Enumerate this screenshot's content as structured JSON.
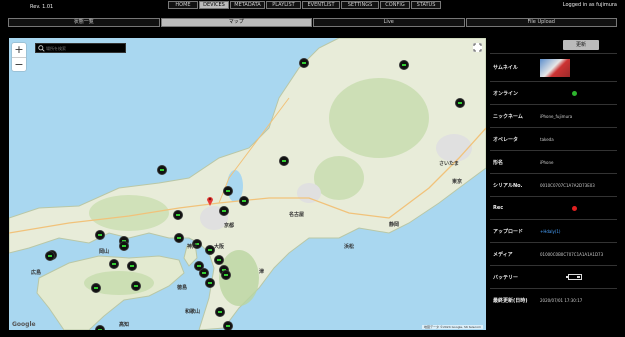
{
  "header": {
    "version": "Rev. 1.01",
    "login": "Logged in as fujimura"
  },
  "nav": [
    "HOME",
    "DEVICES",
    "METADATA",
    "PLAYLIST",
    "EVENTLIST",
    "SETTINGS",
    "CONFIG",
    "STATUS"
  ],
  "nav_active": "DEVICES",
  "subtabs": [
    "状態一覧",
    "マップ",
    "Live",
    "File Upload"
  ],
  "subtab_active": "マップ",
  "map": {
    "search_placeholder": "場所を検索",
    "zoom_in": "+",
    "zoom_out": "−",
    "google": "Google",
    "attribution": "地図データ ©2024 Google, SK telecom",
    "labels": [
      "さいたま",
      "東京",
      "名古屋",
      "静岡",
      "浜松",
      "京都",
      "大阪",
      "神戸",
      "岡山",
      "広島",
      "徳島",
      "高知",
      "和歌山",
      "津"
    ]
  },
  "panel": {
    "update_label": "更新",
    "rows": [
      {
        "label": "サムネイル",
        "type": "thumb"
      },
      {
        "label": "オンライン",
        "type": "dot",
        "color": "#2db52d"
      },
      {
        "label": "ニックネーム",
        "value": "iPhone_fujimura"
      },
      {
        "label": "オペレータ",
        "value": "takeda"
      },
      {
        "label": "形名",
        "value": "iPhone"
      },
      {
        "label": "シリアルNo.",
        "value": "0010C0707C1A7A2D73E03"
      },
      {
        "label": "Rec",
        "type": "dot",
        "color": "#e02020"
      },
      {
        "label": "アップロード",
        "value": "+Hdaly(1)",
        "link": true
      },
      {
        "label": "メディア",
        "value": "01000C0B0C707C1A1A1A1D73"
      },
      {
        "label": "バッテリー",
        "type": "battery"
      },
      {
        "label": "最終更新(日時)",
        "value": "2020/07/01 17:30:17"
      }
    ]
  }
}
